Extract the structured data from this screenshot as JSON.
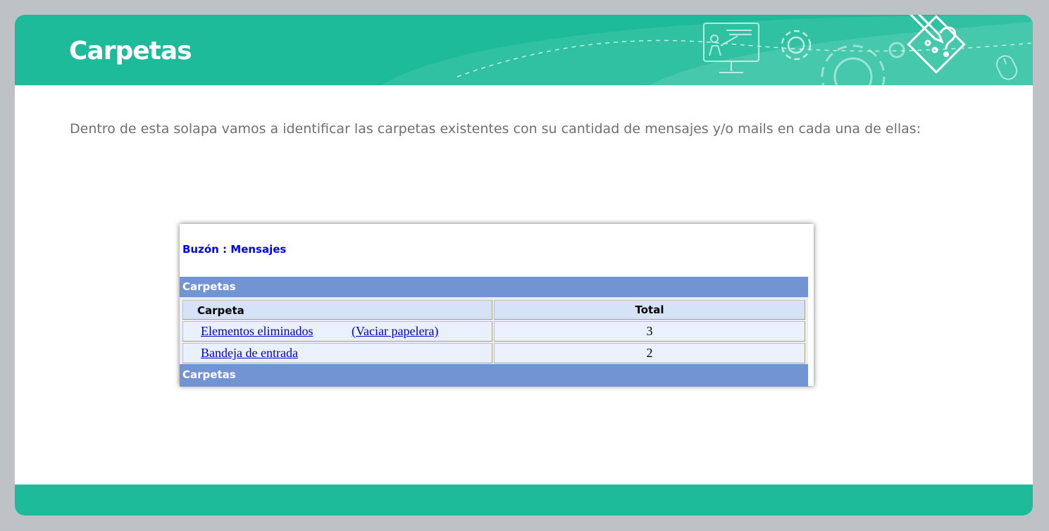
{
  "header": {
    "title": "Carpetas"
  },
  "intro": {
    "text": "Dentro de esta solapa vamos a identificar las carpetas existentes con su cantidad de mensajes y/o mails en cada una de ellas:"
  },
  "screenshot": {
    "mailbox_title": "Buzón : Mensajes",
    "section_top": "Carpetas",
    "section_bottom": "Carpetas",
    "table": {
      "headers": [
        "Carpeta",
        "Total"
      ],
      "rows": [
        {
          "folder": "Elementos eliminados",
          "action": "(Vaciar papelera)",
          "total": "3"
        },
        {
          "folder": "Bandeja de entrada",
          "action": "",
          "total": "2"
        }
      ]
    }
  },
  "colors": {
    "brand": "#1dbb9a",
    "table_bar": "#7294d3",
    "link": "#0000cc",
    "mailbox_title": "#0000ff"
  },
  "icons": [
    "presentation-board-icon",
    "gear-icon",
    "large-gear-icon",
    "pencil-question-icon",
    "mouse-icon"
  ]
}
